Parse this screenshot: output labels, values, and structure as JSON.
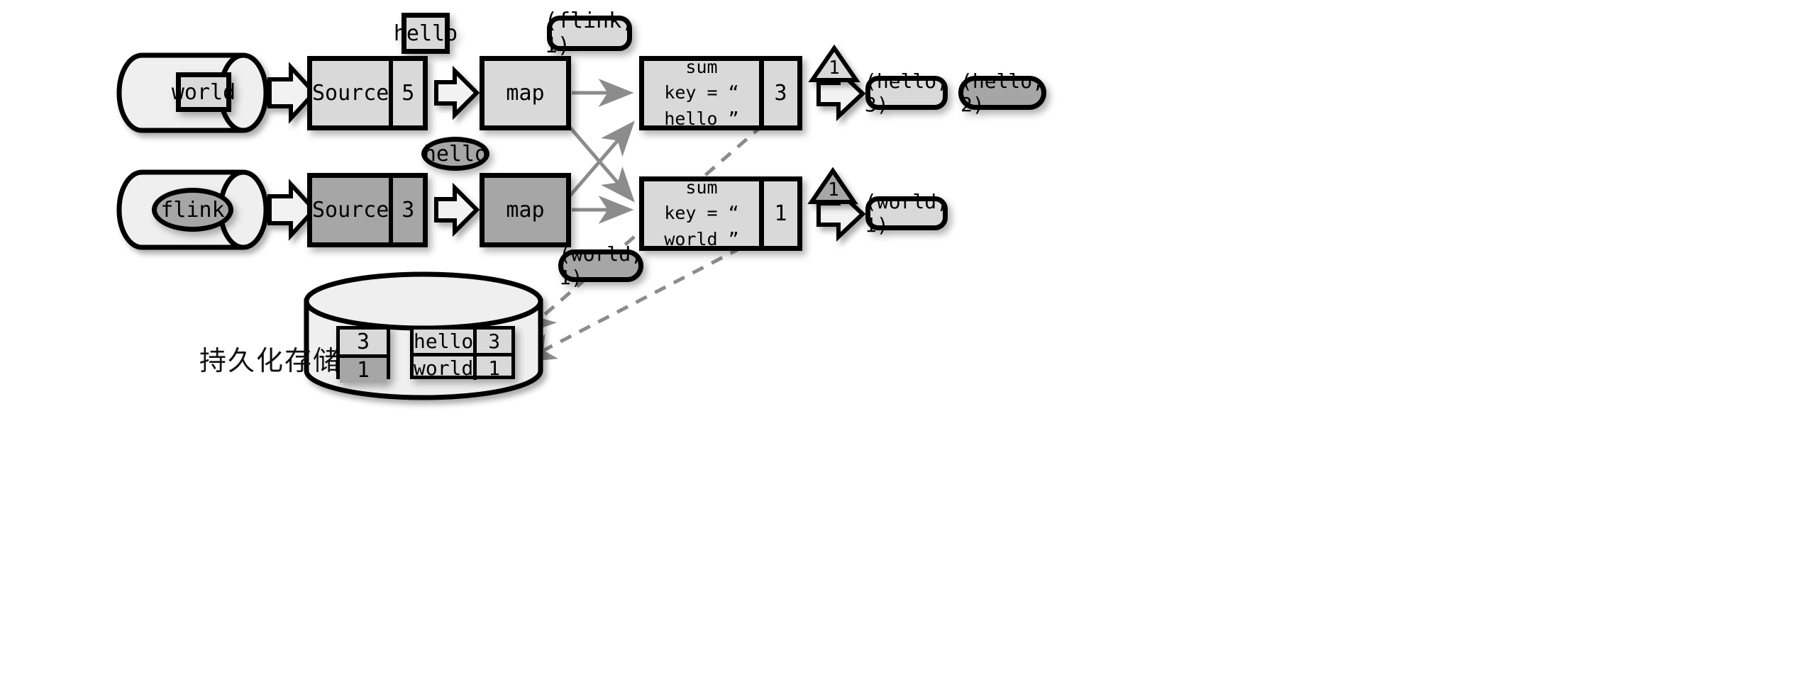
{
  "diagram": {
    "title_cn": "持久化存储",
    "colors": {
      "stroke": "#000000",
      "fill_light": "#d9d9d9",
      "fill_cylinder": "#efefef",
      "fill_dark": "#a6a6a6",
      "arrow_gray": "#8c8c8c",
      "dashed_gray": "#8c8c8c",
      "background": "#ffffff"
    },
    "floating_records": {
      "hello_square": "hello",
      "flink_pill": "(flink, 1)",
      "hello_ellipse": "hello",
      "world_pill": "(world, 1)"
    },
    "rows": [
      {
        "id": "row-1",
        "source_cylinder_item": "world",
        "source_label": "Source",
        "source_offset": "5",
        "map_label": "map",
        "sum_label": "sum",
        "sum_key_label": "key = “ hello ”",
        "sum_value": "3",
        "watermark": "1",
        "outputs": [
          {
            "text": "(hello, 3)",
            "style": "light"
          },
          {
            "text": "(hello, 2)",
            "style": "dark"
          }
        ]
      },
      {
        "id": "row-2",
        "source_cylinder_item": "flink",
        "source_label": "Source",
        "source_offset": "3",
        "map_label": "map",
        "sum_label": "sum",
        "sum_key_label": "key = “ world ”",
        "sum_value": "1",
        "watermark": "1",
        "outputs": [
          {
            "text": "(world, 1)",
            "style": "light"
          }
        ]
      }
    ],
    "storage": {
      "label": "持久化存储",
      "offsets_table": {
        "rows": [
          [
            "3"
          ],
          [
            "1"
          ]
        ]
      },
      "state_table": {
        "rows": [
          [
            "hello",
            "3"
          ],
          [
            "world",
            "1"
          ]
        ]
      }
    }
  }
}
